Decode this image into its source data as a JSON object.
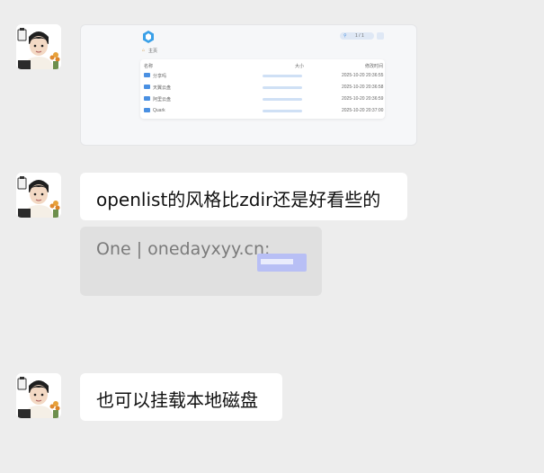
{
  "messages": [
    {
      "type": "image",
      "sender": "user-avatar"
    },
    {
      "type": "text",
      "sender": "user-avatar",
      "text": "openlist的风格比zdir还是好看些的"
    },
    {
      "type": "quote",
      "text": "One | onedayxyy.cn:"
    },
    {
      "type": "text",
      "sender": "user-avatar",
      "text": "也可以挂载本地磁盘"
    }
  ],
  "screenshot": {
    "breadcrumb": "主页",
    "headers": {
      "name": "名称",
      "size": "大小",
      "modified": "修改时间"
    },
    "rows": [
      {
        "name": "分享吗",
        "date": "2025-10-20 20:36:55"
      },
      {
        "name": "天翼云盘",
        "date": "2025-10-20 20:36:58"
      },
      {
        "name": "阿里云盘",
        "date": "2025-10-20 20:36:59"
      },
      {
        "name": "Quark",
        "date": "2025-10-20 20:37:00"
      }
    ],
    "pager": "1 / 1"
  },
  "colors": {
    "background": "#ededed",
    "bubble": "#ffffff",
    "quote": "#e0e0e0",
    "accent": "#4a90e2"
  }
}
